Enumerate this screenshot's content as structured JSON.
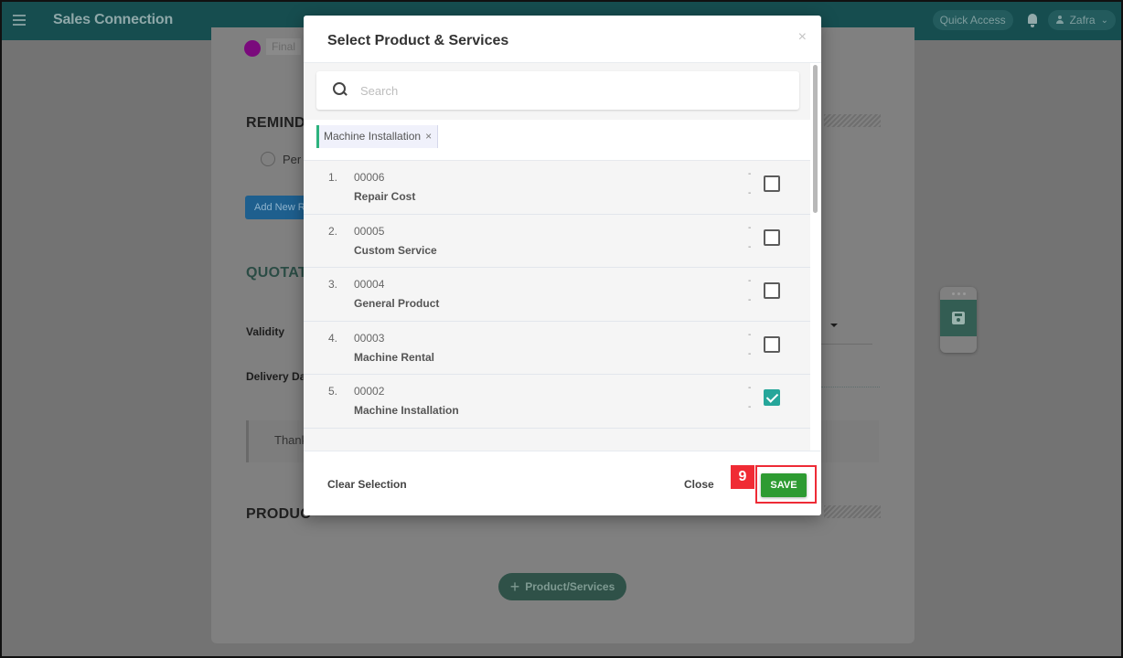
{
  "topbar": {
    "app_title": "Sales Connection",
    "quick_access_label": "Quick Access",
    "user_name": "Zafra",
    "icons": {
      "menu": "hamburger-menu-icon",
      "notifications": "bell-icon",
      "user": "user-icon",
      "dropdown": "chevron-down-icon"
    }
  },
  "background_page": {
    "step_label": "Final",
    "reminder_section_title": "REMIND",
    "reminder_radio_label": "Per",
    "add_new_button": "Add New R",
    "quotation_section_title": "QUOTAT",
    "validity_label": "Validity",
    "delivery_label": "Delivery Da",
    "thanks_text": "Thank",
    "products_section_title": "PRODUC",
    "add_product_button": "Product/Services",
    "add_product_icon": "+",
    "float_save_icon": "floppy-disk-icon"
  },
  "modal": {
    "title": "Select Product & Services",
    "close_icon": "×",
    "search": {
      "placeholder": "Search",
      "value": ""
    },
    "selected_chips": [
      {
        "label": "Machine Installation",
        "remove_icon": "×"
      }
    ],
    "items": [
      {
        "index": "1.",
        "code": "00006",
        "name": "Repair Cost",
        "meta1": "-",
        "meta2": "-",
        "checked": false
      },
      {
        "index": "2.",
        "code": "00005",
        "name": "Custom Service",
        "meta1": "-",
        "meta2": "-",
        "checked": false
      },
      {
        "index": "3.",
        "code": "00004",
        "name": "General Product",
        "meta1": "-",
        "meta2": "-",
        "checked": false
      },
      {
        "index": "4.",
        "code": "00003",
        "name": "Machine Rental",
        "meta1": "-",
        "meta2": "-",
        "checked": false
      },
      {
        "index": "5.",
        "code": "00002",
        "name": "Machine Installation",
        "meta1": "-",
        "meta2": "-",
        "checked": true
      }
    ],
    "footer": {
      "clear_selection_label": "Clear Selection",
      "close_label": "Close",
      "save_label": "SAVE"
    }
  },
  "annotation": {
    "step_number": "9",
    "color": "#f02b34"
  },
  "colors": {
    "topbar": "#164d4f",
    "save_button": "#2e9b32",
    "checkbox_checked": "#26a69a",
    "chip_accent": "#2db37e"
  }
}
